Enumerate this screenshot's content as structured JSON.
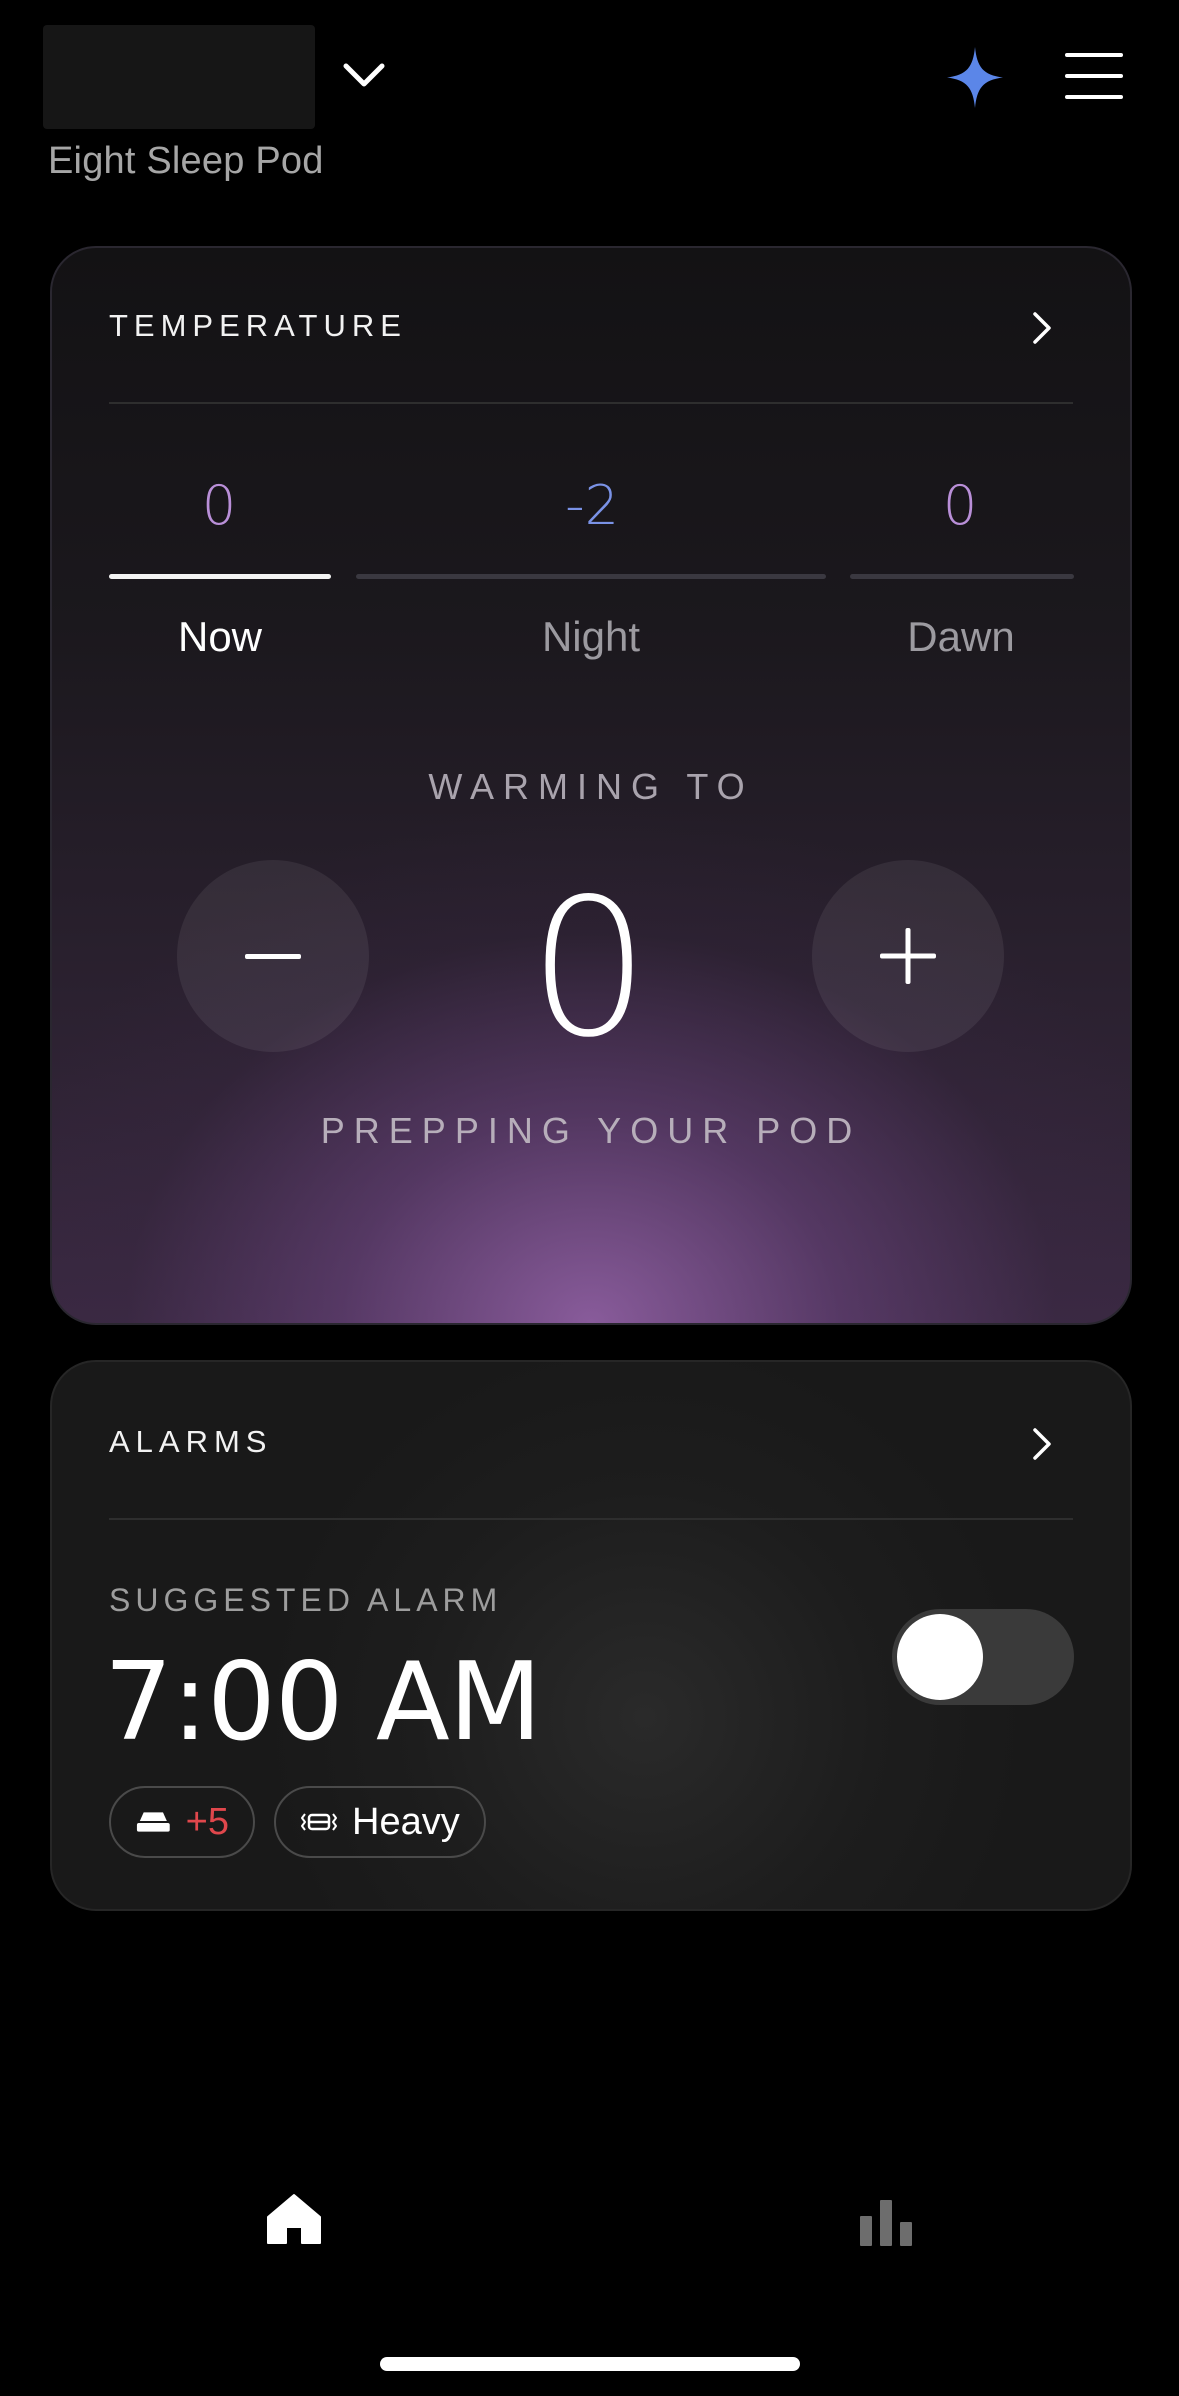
{
  "header": {
    "device_name": "Eight Sleep Pod"
  },
  "temperature": {
    "title": "TEMPERATURE",
    "tabs": [
      {
        "value": "0",
        "label": "Now",
        "value_color": "#b98fd8",
        "active": true
      },
      {
        "value": "-2",
        "label": "Night",
        "value_color": "#7a92e6",
        "active": false
      },
      {
        "value": "0",
        "label": "Dawn",
        "value_color": "#b98fd8",
        "active": false
      }
    ],
    "status_top": "WARMING TO",
    "current_value": "0",
    "status_bottom": "PREPPING YOUR POD"
  },
  "alarms": {
    "title": "ALARMS",
    "subtitle": "SUGGESTED ALARM",
    "time": "7:00 AM",
    "toggle_on": false,
    "chips": [
      {
        "icon": "bed-icon",
        "text": "+5",
        "text_color": "#e0474c"
      },
      {
        "icon": "vibration-icon",
        "text": "Heavy",
        "text_color": "#ffffff"
      }
    ]
  },
  "nav": {
    "items": [
      "home-icon",
      "stats-icon"
    ]
  },
  "colors": {
    "accent_blue": "#5b86e8",
    "purple": "#b98fd8"
  }
}
